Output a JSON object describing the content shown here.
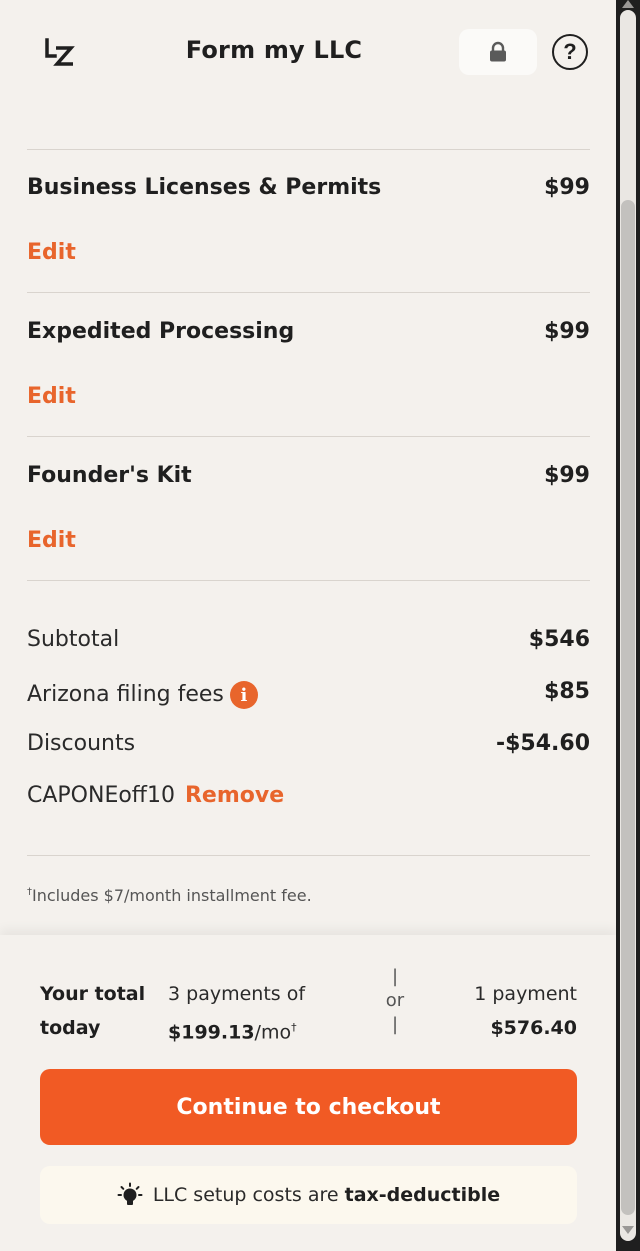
{
  "header": {
    "logo_text": "LZ",
    "title": "Form my LLC",
    "lock_icon": "lock-icon",
    "help_icon": "question-circle-icon",
    "help_glyph": "?"
  },
  "line_items": [
    {
      "name": "Business Licenses & Permits",
      "price": "$99",
      "edit_label": "Edit"
    },
    {
      "name": "Expedited Processing",
      "price": "$99",
      "edit_label": "Edit"
    },
    {
      "name": "Founder's Kit",
      "price": "$99",
      "edit_label": "Edit"
    }
  ],
  "summary": {
    "subtotal_label": "Subtotal",
    "subtotal_value": "$546",
    "filing_label": "Arizona filing fees",
    "filing_info_glyph": "i",
    "filing_value": "$85",
    "discounts_label": "Discounts",
    "discounts_value": "-$54.60",
    "coupon_code": "CAPONEoff10",
    "remove_label": "Remove"
  },
  "footnote": {
    "mark": "†",
    "text": "Includes $7/month installment fee."
  },
  "total": {
    "label_line1": "Your total",
    "label_line2": "today",
    "installment_line1": "3 payments of",
    "installment_amount": "$199.13",
    "installment_unit": "/mo",
    "installment_mark": "†",
    "or_top": "|",
    "or_text": "or",
    "or_bottom": "|",
    "single_line1": "1 payment",
    "single_amount": "$576.40"
  },
  "checkout_label": "Continue to checkout",
  "tax_banner": {
    "icon": "lightbulb-icon",
    "text": "LLC setup costs are",
    "bold": "tax-deductible"
  },
  "colors": {
    "accent": "#f15a24",
    "link": "#e8652c",
    "background": "#f4f1ed"
  }
}
